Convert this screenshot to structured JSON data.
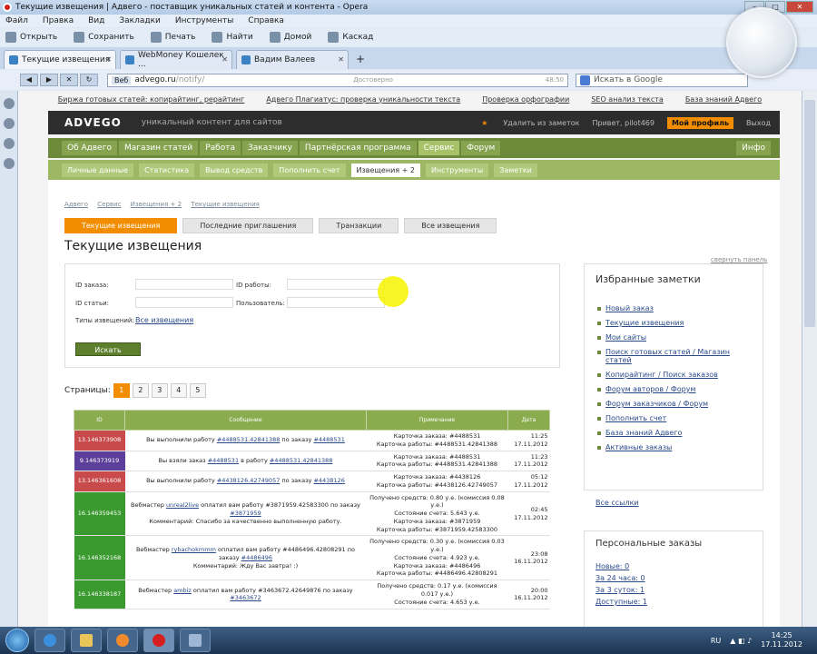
{
  "window": {
    "title": "Текущие извещения | Адвего - поставщик уникальных статей и контента - Opera"
  },
  "menu": [
    "Файл",
    "Правка",
    "Вид",
    "Закладки",
    "Инструменты",
    "Справка"
  ],
  "toolbar": [
    "Открыть",
    "Сохранить",
    "Печать",
    "Найти",
    "Домой",
    "Каскад"
  ],
  "tabs": [
    "Текущие извещения",
    "WebMoney Кошелек ...",
    "Вадим Валеев"
  ],
  "address": {
    "label": "Веб",
    "url": "advego.ru",
    "url_dim": "/notify/",
    "secure_label": "Достоверно",
    "secure_time": "48:50",
    "search_placeholder": "Искать в Google"
  },
  "topstrip": [
    "Биржа готовых статей: копирайтинг, рерайтинг",
    "Адвего Плагиатус: проверка уникальности текста",
    "Проверка орфографии",
    "SEO анализ текста",
    "База знаний Адвего"
  ],
  "header": {
    "logo": "ADVEGO",
    "slogan": "уникальный контент для сайтов",
    "notes": "Удалить из заметок",
    "hello": "Привет, pilot469",
    "profile": "Мой профиль",
    "logout": "Выход"
  },
  "nav1": [
    "Об Адвего",
    "Магазин статей",
    "Работа",
    "Заказчику",
    "Партнёрская программа",
    "Сервис",
    "Форум"
  ],
  "nav1_info": "Инфо",
  "nav2": [
    "Личные данные",
    "Статистика",
    "Вывод средств",
    "Пополнить счет",
    "Извещения + 2",
    "Инструменты",
    "Заметки"
  ],
  "crumbs": [
    "Адвего",
    "Сервис",
    "Извещения + 2",
    "Текущие извещения"
  ],
  "subtabs": [
    "Текущие извещения",
    "Последние приглашения",
    "Транзакции",
    "Все извещения"
  ],
  "page_title": "Текущие извещения",
  "hide_panel": "свернуть панель",
  "filter": {
    "order_id": "ID заказа:",
    "work_id": "ID работы:",
    "article_id": "ID статьи:",
    "user": "Пользователь:",
    "types": "Типы извещений:",
    "types_value": "Все извещения",
    "button": "Искать"
  },
  "pages": {
    "label": "Страницы:",
    "items": [
      "1",
      "2",
      "3",
      "4",
      "5"
    ]
  },
  "table": {
    "headers": [
      "ID",
      "Сообщение",
      "Примечание",
      "Дата"
    ],
    "rows": [
      {
        "id": "13.146373908",
        "color": "#c94a4a",
        "msg_pre": "Вы выполнили работу ",
        "msg_link1": "#4488531.42841388",
        "msg_mid": " по заказу ",
        "msg_link2": "#4488531",
        "msg_post": "",
        "note": [
          "Карточка заказа: #4488531",
          "Карточка работы: #4488531.42841388"
        ],
        "date": [
          "11:25",
          "17.11.2012"
        ]
      },
      {
        "id": "9.146373919",
        "color": "#5b3f9a",
        "msg_pre": "Вы взяли заказ ",
        "msg_link1": "#4488531",
        "msg_mid": " в работу ",
        "msg_link2": "#4488531.42841388",
        "msg_post": "",
        "note": [
          "Карточка заказа: #4488531",
          "Карточка работы: #4488531.42841388"
        ],
        "date": [
          "11:23",
          "17.11.2012"
        ]
      },
      {
        "id": "13.146361608",
        "color": "#c94a4a",
        "msg_pre": "Вы выполнили работу ",
        "msg_link1": "#4438126.42749057",
        "msg_mid": " по заказу ",
        "msg_link2": "#4438126",
        "msg_post": "",
        "note": [
          "Карточка заказа: #4438126",
          "Карточка работы: #4438126.42749057"
        ],
        "date": [
          "05:12",
          "17.11.2012"
        ]
      },
      {
        "id": "16.146359453",
        "color": "#3b9a2f",
        "msg_pre": "Вебмастер ",
        "msg_link1": "unreal2live",
        "msg_mid": " оплатил вам работу #3871959.42583300 по заказу ",
        "msg_link2": "#3871959",
        "msg_post": "Комментарий: Спасибо за качественно выполненную работу.",
        "note": [
          "Получено средств: 0.80 у.е. (комиссия 0.08 у.е.)",
          "Состояние счета: 5.643 у.е.",
          "Карточка заказа: #3871959",
          "Карточка работы: #3871959.42583300"
        ],
        "date": [
          "02:45",
          "17.11.2012"
        ]
      },
      {
        "id": "16.146352168",
        "color": "#3b9a2f",
        "msg_pre": "Вебмастер ",
        "msg_link1": "rybachokmmm",
        "msg_mid": " оплатил вам работу #4486496.42808291 по заказу ",
        "msg_link2": "#4486496",
        "msg_post": "Комментарий: Жду Вас завтра! :)",
        "note": [
          "Получено средств: 0.30 у.е. (комиссия 0.03 у.е.)",
          "Состояние счета: 4.923 у.е.",
          "Карточка заказа: #4486496",
          "Карточка работы: #4486496.42808291"
        ],
        "date": [
          "23:08",
          "16.11.2012"
        ]
      },
      {
        "id": "16.146338187",
        "color": "#3b9a2f",
        "msg_pre": "Вебмастер ",
        "msg_link1": "ambiz",
        "msg_mid": " оплатил вам работу #3463672.42649876 по заказу ",
        "msg_link2": "#3463672",
        "msg_post": "",
        "note": [
          "Получено средств: 0.17 у.е. (комиссия 0.017 у.е.)",
          "Состояние счета: 4.653 у.е."
        ],
        "date": [
          "20:00",
          "16.11.2012"
        ]
      }
    ]
  },
  "favorites": {
    "title": "Избранные заметки",
    "items": [
      "Новый заказ",
      "Текущие извещения",
      "Мои сайты",
      "Поиск готовых статей / Магазин статей",
      "Копирайтинг / Поиск заказов",
      "Форум авторов / Форум",
      "Форум заказчиков / Форум",
      "Пополнить счет",
      "База знаний Адвего",
      "Активные заказы"
    ],
    "all": "Все ссылки"
  },
  "personal": {
    "title": "Персональные заказы",
    "items": [
      "Новые: 0",
      "За 24 часа: 0",
      "За 3 суток: 1",
      "Доступные: 1"
    ]
  },
  "tray": {
    "lang": "RU",
    "time": "14:25",
    "date": "17.11.2012"
  }
}
